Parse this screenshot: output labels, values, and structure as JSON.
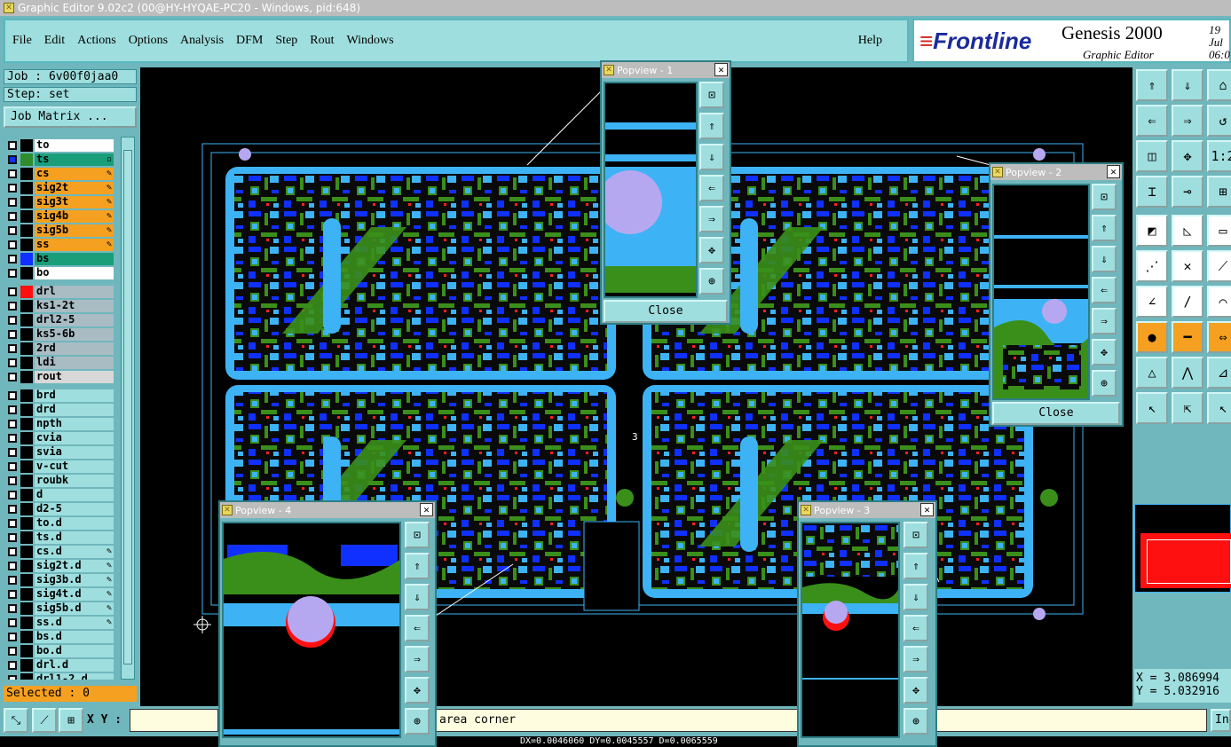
{
  "window": {
    "title": "Graphic Editor 9.02c2 (00@HY-HYQAE-PC20 - Windows, pid:648)"
  },
  "menu": {
    "file": "File",
    "edit": "Edit",
    "actions": "Actions",
    "options": "Options",
    "analysis": "Analysis",
    "dfm": "DFM",
    "step": "Step",
    "rout": "Rout",
    "windows": "Windows",
    "help": "Help"
  },
  "brand": {
    "logo": "Frontline",
    "product": "Genesis 2000",
    "subtitle": "Graphic Editor",
    "date": "19 Jul",
    "time": "06:0"
  },
  "job": {
    "job_label": "Job : 6v00f0jaa0",
    "step_label": "Step: set",
    "matrix_button": "Job Matrix ..."
  },
  "layers": [
    {
      "name": "to",
      "color": "#ffffff",
      "swatch": "#000000",
      "ed": ""
    },
    {
      "name": "ts",
      "color": "#1a9e7a",
      "swatch": "#2e8b2e",
      "ed": "▫",
      "active": true
    },
    {
      "name": "cs",
      "color": "#f5a020",
      "swatch": "#000000",
      "ed": "✎"
    },
    {
      "name": "sig2t",
      "color": "#f5a020",
      "swatch": "#000000",
      "ed": "✎"
    },
    {
      "name": "sig3t",
      "color": "#f5a020",
      "swatch": "#000000",
      "ed": "✎"
    },
    {
      "name": "sig4b",
      "color": "#f5a020",
      "swatch": "#000000",
      "ed": "✎"
    },
    {
      "name": "sig5b",
      "color": "#f5a020",
      "swatch": "#000000",
      "ed": "✎"
    },
    {
      "name": "ss",
      "color": "#f5a020",
      "swatch": "#000000",
      "ed": "✎"
    },
    {
      "name": "bs",
      "color": "#1a9e7a",
      "swatch": "#1030ff",
      "ed": ""
    },
    {
      "name": "bo",
      "color": "#ffffff",
      "swatch": "#000000",
      "ed": ""
    },
    {
      "name": "drl",
      "color": "#a9bcc4",
      "swatch": "#ff1010",
      "ed": ""
    },
    {
      "name": "ks1-2t",
      "color": "#a9bcc4",
      "swatch": "#000000",
      "ed": ""
    },
    {
      "name": "drl2-5",
      "color": "#a9bcc4",
      "swatch": "#000000",
      "ed": ""
    },
    {
      "name": "ks5-6b",
      "color": "#a9bcc4",
      "swatch": "#000000",
      "ed": ""
    },
    {
      "name": "2rd",
      "color": "#a9bcc4",
      "swatch": "#000000",
      "ed": ""
    },
    {
      "name": "ldi",
      "color": "#a9bcc4",
      "swatch": "#000000",
      "ed": ""
    },
    {
      "name": "rout",
      "color": "#d8d8d8",
      "swatch": "#000000",
      "ed": ""
    },
    {
      "name": "brd",
      "color": "#9fdede",
      "swatch": "#000000",
      "ed": ""
    },
    {
      "name": "drd",
      "color": "#9fdede",
      "swatch": "#000000",
      "ed": ""
    },
    {
      "name": "npth",
      "color": "#9fdede",
      "swatch": "#000000",
      "ed": ""
    },
    {
      "name": "cvia",
      "color": "#9fdede",
      "swatch": "#000000",
      "ed": ""
    },
    {
      "name": "svia",
      "color": "#9fdede",
      "swatch": "#000000",
      "ed": ""
    },
    {
      "name": "v-cut",
      "color": "#9fdede",
      "swatch": "#000000",
      "ed": ""
    },
    {
      "name": "roubk",
      "color": "#9fdede",
      "swatch": "#000000",
      "ed": ""
    },
    {
      "name": "d",
      "color": "#9fdede",
      "swatch": "#000000",
      "ed": ""
    },
    {
      "name": "d2-5",
      "color": "#9fdede",
      "swatch": "#000000",
      "ed": ""
    },
    {
      "name": "to.d",
      "color": "#9fdede",
      "swatch": "#000000",
      "ed": ""
    },
    {
      "name": "ts.d",
      "color": "#9fdede",
      "swatch": "#000000",
      "ed": ""
    },
    {
      "name": "cs.d",
      "color": "#9fdede",
      "swatch": "#000000",
      "ed": "✎"
    },
    {
      "name": "sig2t.d",
      "color": "#9fdede",
      "swatch": "#000000",
      "ed": "✎"
    },
    {
      "name": "sig3b.d",
      "color": "#9fdede",
      "swatch": "#000000",
      "ed": "✎"
    },
    {
      "name": "sig4t.d",
      "color": "#9fdede",
      "swatch": "#000000",
      "ed": "✎"
    },
    {
      "name": "sig5b.d",
      "color": "#9fdede",
      "swatch": "#000000",
      "ed": "✎"
    },
    {
      "name": "ss.d",
      "color": "#9fdede",
      "swatch": "#000000",
      "ed": "✎"
    },
    {
      "name": "bs.d",
      "color": "#9fdede",
      "swatch": "#000000",
      "ed": ""
    },
    {
      "name": "bo.d",
      "color": "#9fdede",
      "swatch": "#000000",
      "ed": ""
    },
    {
      "name": "drl.d",
      "color": "#9fdede",
      "swatch": "#000000",
      "ed": ""
    },
    {
      "name": "drl1-2.d",
      "color": "#9fdede",
      "swatch": "#000000",
      "ed": ""
    }
  ],
  "selected": "Selected : 0",
  "coords": {
    "x": "X = 3.086994",
    "y": "Y = 5.032916"
  },
  "status": {
    "xy_label": "X Y :",
    "xy_value": "",
    "prompt": "area corner",
    "in_button": "In",
    "bottom_readout": "DX=0.0046060 DY=0.0045557 D=0.0065559"
  },
  "popviews": [
    {
      "title": "Popview - 1",
      "close": "Close"
    },
    {
      "title": "Popview - 2",
      "close": "Close"
    },
    {
      "title": "Popview - 3",
      "close": "Close"
    },
    {
      "title": "Popview - 4",
      "close": "Close"
    }
  ],
  "canvas_marks": {
    "label_3": "3"
  },
  "colors": {
    "panel": "#6fb7bd",
    "accent": "#9fdede",
    "highlight": "#f5a020",
    "board_light": "#3db3f5",
    "board_dark": "#1030ff",
    "board_green": "#3a8f1a"
  }
}
